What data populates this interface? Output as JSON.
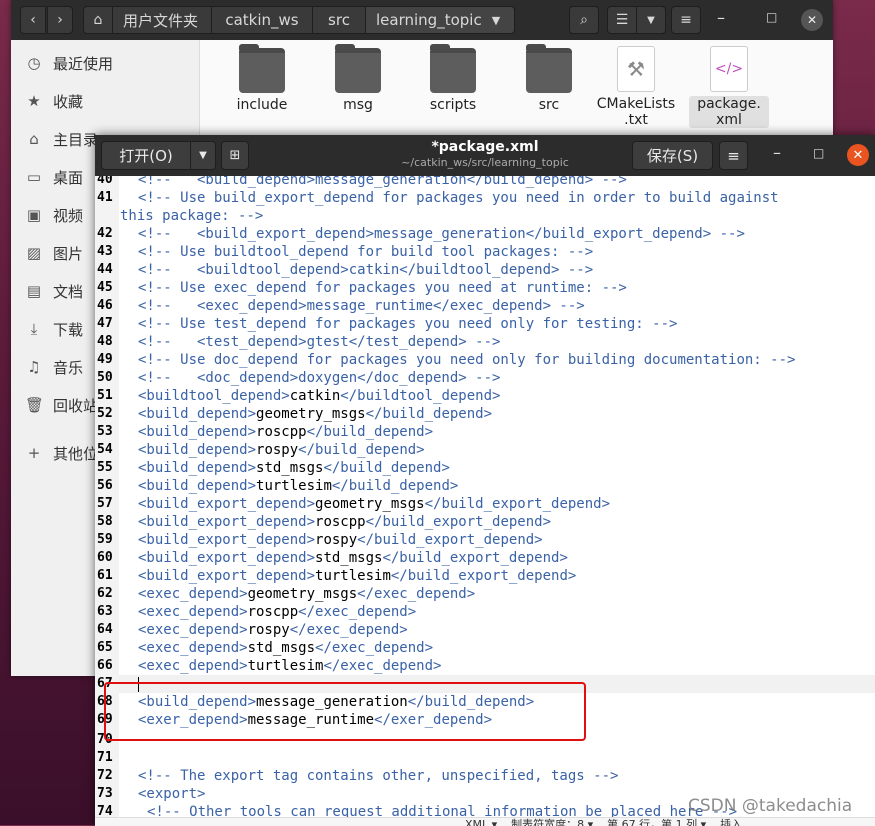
{
  "file_manager": {
    "breadcrumbs": [
      "用户文件夹",
      "catkin_ws",
      "src",
      "learning_topic"
    ],
    "sidebar": [
      {
        "icon": "clock-icon",
        "glyph": "◷",
        "label": "最近使用"
      },
      {
        "icon": "star-icon",
        "glyph": "★",
        "label": "收藏"
      },
      {
        "icon": "home-icon",
        "glyph": "⌂",
        "label": "主目录"
      },
      {
        "icon": "desktop-icon",
        "glyph": "▭",
        "label": "桌面"
      },
      {
        "icon": "video-icon",
        "glyph": "▣",
        "label": "视频"
      },
      {
        "icon": "image-icon",
        "glyph": "▨",
        "label": "图片"
      },
      {
        "icon": "document-icon",
        "glyph": "▤",
        "label": "文档"
      },
      {
        "icon": "download-icon",
        "glyph": "⤓",
        "label": "下载"
      },
      {
        "icon": "music-icon",
        "glyph": "♫",
        "label": "音乐"
      },
      {
        "icon": "trash-icon",
        "glyph": "🗑",
        "label": "回收站"
      },
      {
        "icon": "plus-icon",
        "glyph": "+",
        "label": "其他位置"
      }
    ],
    "files": [
      {
        "name": "include",
        "type": "folder"
      },
      {
        "name": "msg",
        "type": "folder"
      },
      {
        "name": "scripts",
        "type": "folder"
      },
      {
        "name": "src",
        "type": "folder"
      },
      {
        "name": "CMakeLists\n.txt",
        "type": "cmake"
      },
      {
        "name": "package.\nxml",
        "type": "xml"
      }
    ]
  },
  "editor": {
    "open_label": "打开(O)",
    "save_label": "保存(S)",
    "title": "*package.xml",
    "path": "~/catkin_ws/src/learning_topic",
    "status_text": "XML ▾    制表符宽度：8 ▾    第 67 行，第 1 列 ▾    插入"
  },
  "code_lines": [
    {
      "n": "40",
      "segs": [
        [
          "cmt",
          "<!--   <build_depend>message_generation</build_depend> -->"
        ]
      ]
    },
    {
      "n": "41",
      "segs": [
        [
          "cmt",
          "<!-- Use build_export_depend for packages you need in order to build against"
        ]
      ]
    },
    {
      "n": "",
      "wrap": true,
      "segs": [
        [
          "cmt",
          "this package: -->"
        ]
      ]
    },
    {
      "n": "42",
      "segs": [
        [
          "cmt",
          "<!--   <build_export_depend>message_generation</build_export_depend> -->"
        ]
      ]
    },
    {
      "n": "43",
      "segs": [
        [
          "cmt",
          "<!-- Use buildtool_depend for build tool packages: -->"
        ]
      ]
    },
    {
      "n": "44",
      "segs": [
        [
          "cmt",
          "<!--   <buildtool_depend>catkin</buildtool_depend> -->"
        ]
      ]
    },
    {
      "n": "45",
      "segs": [
        [
          "cmt",
          "<!-- Use exec_depend for packages you need at runtime: -->"
        ]
      ]
    },
    {
      "n": "46",
      "segs": [
        [
          "cmt",
          "<!--   <exec_depend>message_runtime</exec_depend> -->"
        ]
      ]
    },
    {
      "n": "47",
      "segs": [
        [
          "cmt",
          "<!-- Use test_depend for packages you need only for testing: -->"
        ]
      ]
    },
    {
      "n": "48",
      "segs": [
        [
          "cmt",
          "<!--   <test_depend>gtest</test_depend> -->"
        ]
      ]
    },
    {
      "n": "49",
      "segs": [
        [
          "cmt",
          "<!-- Use doc_depend for packages you need only for building documentation: -->"
        ]
      ]
    },
    {
      "n": "50",
      "segs": [
        [
          "cmt",
          "<!--   <doc_depend>doxygen</doc_depend> -->"
        ]
      ]
    },
    {
      "n": "51",
      "segs": [
        [
          "tag",
          "<buildtool_depend>"
        ],
        [
          "val",
          "catkin"
        ],
        [
          "tag",
          "</buildtool_depend>"
        ]
      ]
    },
    {
      "n": "52",
      "segs": [
        [
          "tag",
          "<build_depend>"
        ],
        [
          "val",
          "geometry_msgs"
        ],
        [
          "tag",
          "</build_depend>"
        ]
      ]
    },
    {
      "n": "53",
      "segs": [
        [
          "tag",
          "<build_depend>"
        ],
        [
          "val",
          "roscpp"
        ],
        [
          "tag",
          "</build_depend>"
        ]
      ]
    },
    {
      "n": "54",
      "segs": [
        [
          "tag",
          "<build_depend>"
        ],
        [
          "val",
          "rospy"
        ],
        [
          "tag",
          "</build_depend>"
        ]
      ]
    },
    {
      "n": "55",
      "segs": [
        [
          "tag",
          "<build_depend>"
        ],
        [
          "val",
          "std_msgs"
        ],
        [
          "tag",
          "</build_depend>"
        ]
      ]
    },
    {
      "n": "56",
      "segs": [
        [
          "tag",
          "<build_depend>"
        ],
        [
          "val",
          "turtlesim"
        ],
        [
          "tag",
          "</build_depend>"
        ]
      ]
    },
    {
      "n": "57",
      "segs": [
        [
          "tag",
          "<build_export_depend>"
        ],
        [
          "val",
          "geometry_msgs"
        ],
        [
          "tag",
          "</build_export_depend>"
        ]
      ]
    },
    {
      "n": "58",
      "segs": [
        [
          "tag",
          "<build_export_depend>"
        ],
        [
          "val",
          "roscpp"
        ],
        [
          "tag",
          "</build_export_depend>"
        ]
      ]
    },
    {
      "n": "59",
      "segs": [
        [
          "tag",
          "<build_export_depend>"
        ],
        [
          "val",
          "rospy"
        ],
        [
          "tag",
          "</build_export_depend>"
        ]
      ]
    },
    {
      "n": "60",
      "segs": [
        [
          "tag",
          "<build_export_depend>"
        ],
        [
          "val",
          "std_msgs"
        ],
        [
          "tag",
          "</build_export_depend>"
        ]
      ]
    },
    {
      "n": "61",
      "segs": [
        [
          "tag",
          "<build_export_depend>"
        ],
        [
          "val",
          "turtlesim"
        ],
        [
          "tag",
          "</build_export_depend>"
        ]
      ]
    },
    {
      "n": "62",
      "segs": [
        [
          "tag",
          "<exec_depend>"
        ],
        [
          "val",
          "geometry_msgs"
        ],
        [
          "tag",
          "</exec_depend>"
        ]
      ]
    },
    {
      "n": "63",
      "segs": [
        [
          "tag",
          "<exec_depend>"
        ],
        [
          "val",
          "roscpp"
        ],
        [
          "tag",
          "</exec_depend>"
        ]
      ]
    },
    {
      "n": "64",
      "segs": [
        [
          "tag",
          "<exec_depend>"
        ],
        [
          "val",
          "rospy"
        ],
        [
          "tag",
          "</exec_depend>"
        ]
      ]
    },
    {
      "n": "65",
      "segs": [
        [
          "tag",
          "<exec_depend>"
        ],
        [
          "val",
          "std_msgs"
        ],
        [
          "tag",
          "</exec_depend>"
        ]
      ]
    },
    {
      "n": "66",
      "segs": [
        [
          "tag",
          "<exec_depend>"
        ],
        [
          "val",
          "turtlesim"
        ],
        [
          "tag",
          "</exec_depend>"
        ]
      ]
    },
    {
      "n": "67",
      "current": true,
      "segs": []
    },
    {
      "n": "68",
      "segs": [
        [
          "tag",
          "<build_depend>"
        ],
        [
          "val",
          "message_generation"
        ],
        [
          "tag",
          "</build_depend>"
        ]
      ]
    },
    {
      "n": "69",
      "segs": [
        [
          "tag",
          "<exer_depend>"
        ],
        [
          "val",
          "message_runtime"
        ],
        [
          "tag",
          "</exer_depend>"
        ]
      ]
    },
    {
      "n": "70",
      "segs": []
    },
    {
      "n": "71",
      "segs": []
    },
    {
      "n": "72",
      "segs": [
        [
          "cmt",
          "<!-- The export tag contains other, unspecified, tags -->"
        ]
      ]
    },
    {
      "n": "73",
      "segs": [
        [
          "tag",
          "<export>"
        ]
      ]
    },
    {
      "n": "74",
      "indent": true,
      "segs": [
        [
          "cmt",
          "<!-- Other tools can request additional information be placed here -->"
        ]
      ]
    }
  ],
  "watermark": "CSDN @takedachia"
}
